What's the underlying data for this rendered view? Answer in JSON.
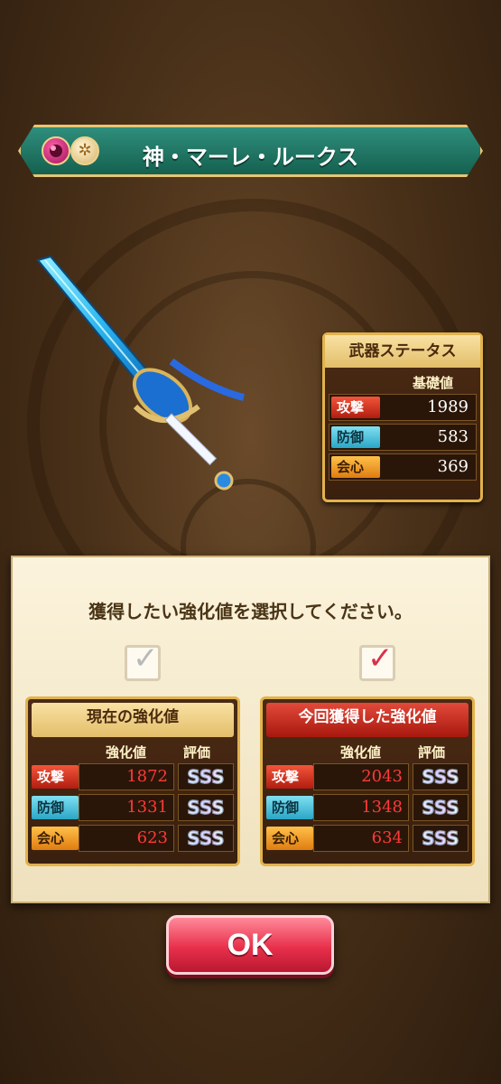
{
  "title": "神・マーレ・ルークス",
  "badges": {
    "element": "element-badge",
    "type": "type-badge"
  },
  "status": {
    "header": "武器ステータス",
    "column": "基礎値",
    "rows": [
      {
        "label": "攻撃",
        "value": "1989"
      },
      {
        "label": "防御",
        "value": "583"
      },
      {
        "label": "会心",
        "value": "369"
      }
    ]
  },
  "instruction": "獲得したい強化値を選択してください。",
  "current": {
    "header": "現在の強化値",
    "col_value": "強化値",
    "col_rank": "評価",
    "checked": false,
    "rows": [
      {
        "label": "攻撃",
        "value": "1872",
        "rank": "SSS"
      },
      {
        "label": "防御",
        "value": "1331",
        "rank": "SSS"
      },
      {
        "label": "会心",
        "value": "623",
        "rank": "SSS"
      }
    ]
  },
  "new": {
    "header": "今回獲得した強化値",
    "col_value": "強化値",
    "col_rank": "評価",
    "checked": true,
    "rows": [
      {
        "label": "攻撃",
        "value": "2043",
        "rank": "SSS"
      },
      {
        "label": "防御",
        "value": "1348",
        "rank": "SSS"
      },
      {
        "label": "会心",
        "value": "634",
        "rank": "SSS"
      }
    ]
  },
  "ok_label": "OK",
  "colors": {
    "accent": "#e8304c",
    "teal": "#1f7a67",
    "gold": "#e2b24c"
  }
}
